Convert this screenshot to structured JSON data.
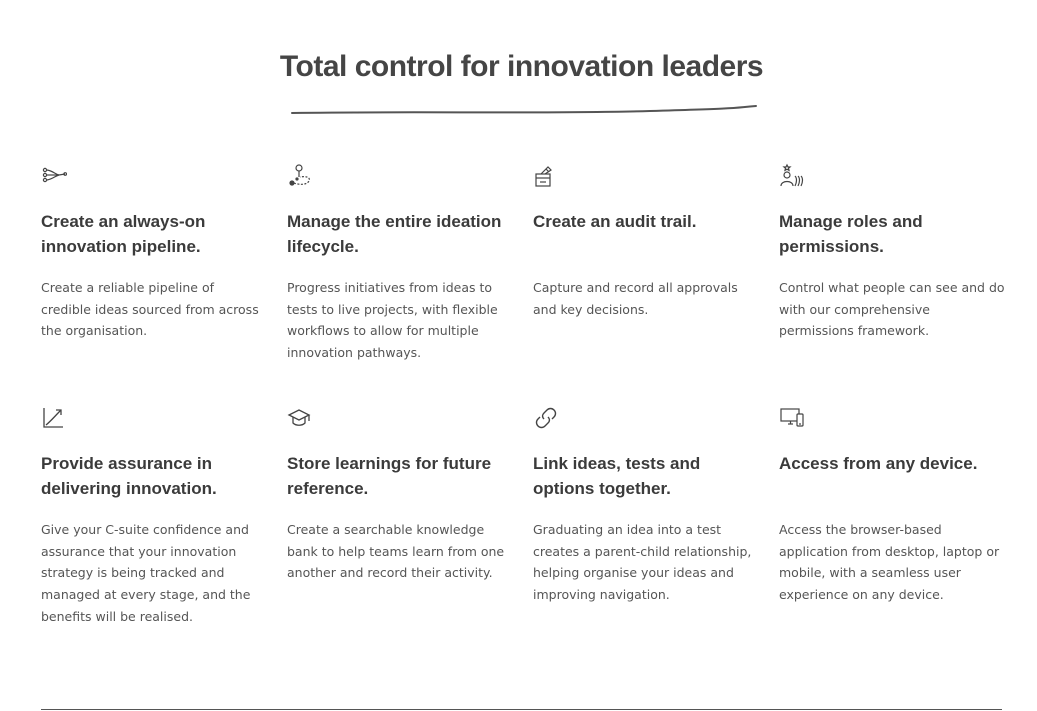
{
  "section": {
    "title": "Total control for innovation leaders"
  },
  "features": [
    {
      "icon": "pipeline-icon",
      "heading": "Create an always-on innovation pipeline.",
      "description": "Create a reliable pipeline of credible ideas sourced from across the organisation."
    },
    {
      "icon": "lifecycle-path-icon",
      "heading": "Manage the entire ideation lifecycle.",
      "description": "Progress initiatives from ideas to tests to live projects, with flexible workflows to allow for multiple innovation pathways."
    },
    {
      "icon": "audit-box-icon",
      "heading": "Create an audit trail.",
      "description": "Capture and record all approvals and key decisions."
    },
    {
      "icon": "users-roles-icon",
      "heading": "Manage roles and permissions.",
      "description": "Control what people can see and do with our comprehensive permissions framework."
    },
    {
      "icon": "growth-chart-icon",
      "heading": "Provide assurance in delivering innovation.",
      "description": "Give your C-suite confidence and assurance that your innovation strategy is being tracked and managed at every stage, and the benefits will be realised."
    },
    {
      "icon": "graduation-cap-icon",
      "heading": "Store learnings for future reference.",
      "description": "Create a searchable knowledge bank to help teams learn from one another and record their activity."
    },
    {
      "icon": "link-icon",
      "heading": "Link ideas, tests and options together.",
      "description": "Graduating an idea into a test creates a parent-child relationship, helping organise your ideas and improving navigation."
    },
    {
      "icon": "devices-icon",
      "heading": "Access from any device.",
      "description": "Access the browser-based application from desktop, laptop or mobile, with a seamless user experience on any device."
    }
  ]
}
